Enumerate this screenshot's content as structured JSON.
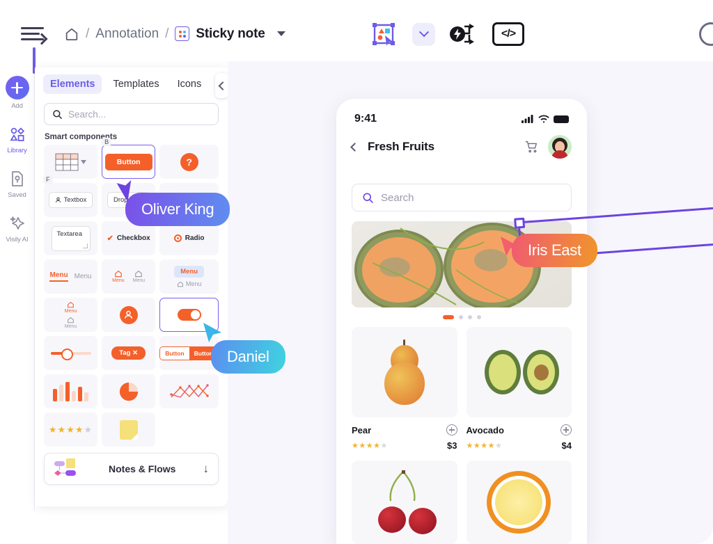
{
  "topbar": {
    "menu_icon": "hamburger-menu-icon",
    "breadcrumb": {
      "home_icon": "home-icon",
      "sep": "/",
      "project": "Annotation",
      "page_icon": "sticky-note-icon",
      "page": "Sticky note",
      "caret_icon": "chevron-down-icon"
    },
    "tools": [
      {
        "name": "select-frame-tool",
        "icon": "frame-select-icon"
      },
      {
        "name": "tool-dropdown",
        "icon": "chevron-down-icon"
      },
      {
        "name": "auto-flow-tool",
        "icon": "lightning-flow-icon"
      },
      {
        "name": "code-view-tool",
        "icon": "code-brackets-icon",
        "label": "</>"
      }
    ]
  },
  "rail": {
    "items": [
      {
        "label": "Add",
        "icon": "plus-circle-icon",
        "active": false
      },
      {
        "label": "Library",
        "icon": "shapes-library-icon",
        "active": true
      },
      {
        "label": "Saved",
        "icon": "saved-file-icon",
        "active": false
      },
      {
        "label": "Visily AI",
        "icon": "sparkle-ai-icon",
        "active": false
      }
    ]
  },
  "panel": {
    "tabs": [
      {
        "label": "Elements",
        "active": true
      },
      {
        "label": "Templates",
        "active": false
      },
      {
        "label": "Icons",
        "active": false
      }
    ],
    "collapse_icon": "chevron-left-icon",
    "search": {
      "placeholder": "Search...",
      "value": "",
      "icon": "search-icon"
    },
    "section_title": "Smart components",
    "components": [
      {
        "name": "table",
        "label": "",
        "badge": "",
        "selected": false
      },
      {
        "name": "button",
        "label": "Button",
        "badge": "B",
        "selected": true
      },
      {
        "name": "help-tooltip",
        "label": "?",
        "badge": "",
        "selected": false
      },
      {
        "name": "textbox",
        "label": "Textbox",
        "badge": "F",
        "selected": false
      },
      {
        "name": "dropdown",
        "label": "Dropdown",
        "badge": "",
        "selected": false
      },
      {
        "name": "radio-button",
        "label": "Radio",
        "badge": "",
        "selected": false
      },
      {
        "name": "textarea",
        "label": "Textarea",
        "badge": "",
        "selected": false
      },
      {
        "name": "checkbox",
        "label": "Checkbox",
        "badge": "",
        "selected": false
      },
      {
        "name": "radio",
        "label": "Radio",
        "badge": "",
        "selected": false
      },
      {
        "name": "tabs-menu",
        "label": "Menu",
        "badge": "",
        "selected": false
      },
      {
        "name": "icon-menu",
        "label": "Menu",
        "badge": "",
        "selected": false
      },
      {
        "name": "pill-menu",
        "label": "Menu",
        "badge": "",
        "selected": false
      },
      {
        "name": "vertical-menu",
        "label": "Menu",
        "badge": "",
        "selected": false
      },
      {
        "name": "avatar",
        "label": "",
        "badge": "",
        "selected": false
      },
      {
        "name": "toggle",
        "label": "",
        "badge": "",
        "selected": false
      },
      {
        "name": "slider",
        "label": "",
        "badge": "",
        "selected": false
      },
      {
        "name": "tag",
        "label": "Tag",
        "badge": "",
        "selected": false
      },
      {
        "name": "segmented-button",
        "label": "Button",
        "badge": "",
        "selected": false
      },
      {
        "name": "bar-chart",
        "label": "",
        "badge": "",
        "selected": false
      },
      {
        "name": "pie-chart",
        "label": "",
        "badge": "",
        "selected": false
      },
      {
        "name": "line-chart",
        "label": "",
        "badge": "",
        "selected": false
      },
      {
        "name": "rating-stars",
        "label": "",
        "badge": "",
        "selected": false
      },
      {
        "name": "sticky-note",
        "label": "",
        "badge": "",
        "selected": false
      }
    ],
    "labels": {
      "button": "Button",
      "help": "?",
      "textbox": "Textbox",
      "dropdown": "Dropdown",
      "textarea": "Textarea",
      "checkbox": "Checkbox",
      "radio": "Radio",
      "menu": "Menu",
      "tag": "Tag ✕",
      "seg_a": "Button",
      "seg_b": "Button",
      "badge_b": "B",
      "badge_f": "F"
    },
    "notes_flows": {
      "label": "Notes & Flows",
      "arrow_icon": "arrow-down-icon"
    }
  },
  "canvas": {
    "phone": {
      "status": {
        "time": "9:41",
        "signal_icon": "cellular-signal-icon",
        "wifi_icon": "wifi-icon",
        "battery_icon": "battery-icon"
      },
      "header": {
        "back_icon": "chevron-left-icon",
        "title": "Fresh Fruits",
        "cart_icon": "shopping-cart-icon",
        "avatar": "user-avatar"
      },
      "search": {
        "placeholder": "Search",
        "icon": "search-icon"
      },
      "carousel": {
        "dots": 4,
        "active_index": 0,
        "image": "cantaloupe-halves"
      },
      "products": [
        {
          "name": "Pear",
          "price": "$3",
          "rating": 4,
          "max_rating": 5,
          "image": "pear",
          "add_icon": "plus-circle-icon"
        },
        {
          "name": "Avocado",
          "price": "$4",
          "rating": 4,
          "max_rating": 5,
          "image": "avocado",
          "add_icon": "plus-circle-icon"
        },
        {
          "name": "",
          "price": "",
          "rating": 0,
          "max_rating": 5,
          "image": "cherries",
          "add_icon": "plus-circle-icon"
        },
        {
          "name": "",
          "price": "",
          "rating": 0,
          "max_rating": 5,
          "image": "lemon",
          "add_icon": "plus-circle-icon"
        }
      ]
    },
    "collaborators": [
      {
        "name": "Oliver King",
        "color_from": "#7b4fe8",
        "color_to": "#5f8ef0",
        "cursor": "#6c43e0"
      },
      {
        "name": "Iris East",
        "color_from": "#f05a72",
        "color_to": "#f0962a",
        "cursor": "#f2606e"
      },
      {
        "name": "Daniel",
        "color_from": "#5b8ef0",
        "color_to": "#3fd3e0",
        "cursor": "#3bb6e6"
      }
    ],
    "selection": {
      "target": "search-bar",
      "handles": 4,
      "color": "#6c43e0"
    }
  }
}
